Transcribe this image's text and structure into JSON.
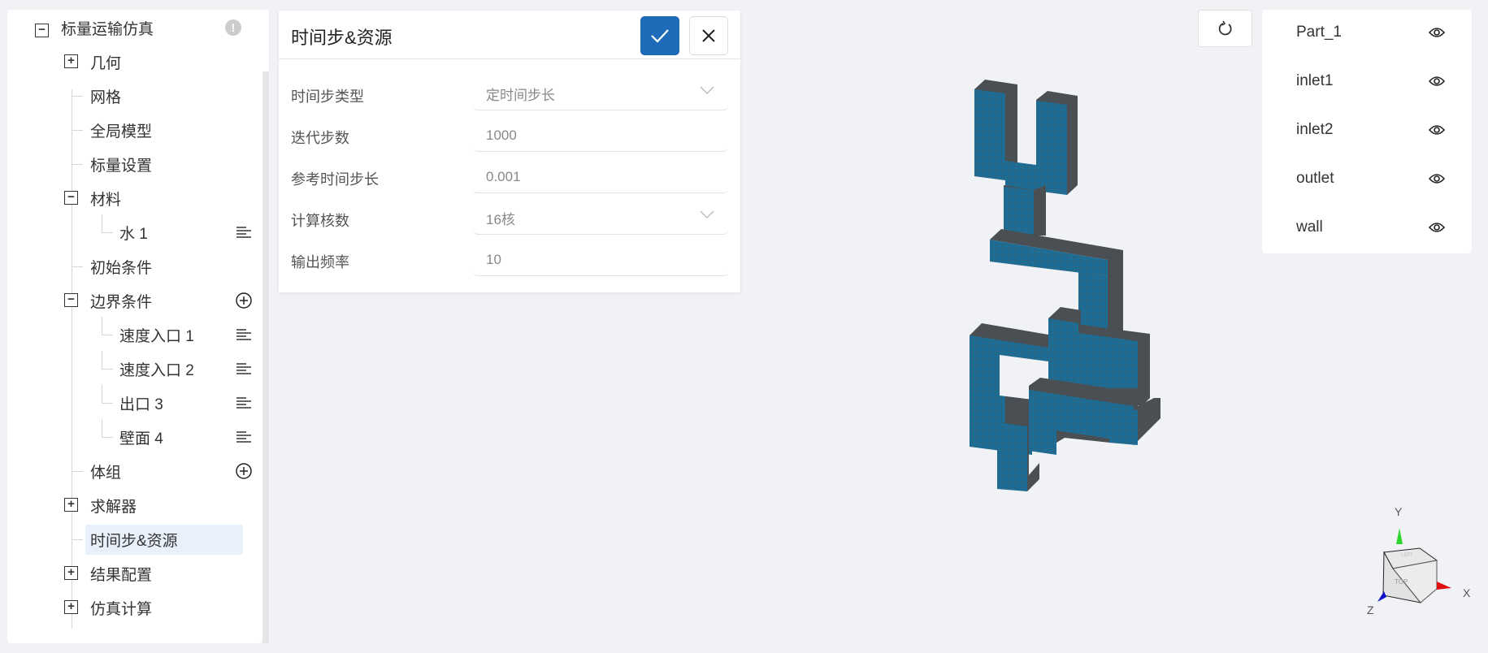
{
  "tree": {
    "root": "标量运输仿真",
    "items": [
      {
        "label": "几何",
        "type": "plus"
      },
      {
        "label": "网格",
        "type": "leaf"
      },
      {
        "label": "全局模型",
        "type": "leaf"
      },
      {
        "label": "标量设置",
        "type": "leaf"
      },
      {
        "label": "材料",
        "type": "minus"
      },
      {
        "label": "水 1",
        "type": "child"
      },
      {
        "label": "初始条件",
        "type": "leaf"
      },
      {
        "label": "边界条件",
        "type": "minus"
      },
      {
        "label": "速度入口 1",
        "type": "child"
      },
      {
        "label": "速度入口 2",
        "type": "child"
      },
      {
        "label": "出口 3",
        "type": "child"
      },
      {
        "label": "壁面 4",
        "type": "child"
      },
      {
        "label": "体组",
        "type": "leaf"
      },
      {
        "label": "求解器",
        "type": "plus"
      },
      {
        "label": "时间步&资源",
        "type": "leaf",
        "selected": true
      },
      {
        "label": "结果配置",
        "type": "plus"
      },
      {
        "label": "仿真计算",
        "type": "plus"
      }
    ]
  },
  "dialog": {
    "title": "时间步&资源",
    "fields": [
      {
        "label": "时间步类型",
        "value": "定时间步长",
        "type": "select"
      },
      {
        "label": "迭代步数",
        "value": "1000",
        "type": "input"
      },
      {
        "label": "参考时间步长",
        "value": "0.001",
        "type": "input"
      },
      {
        "label": "计算核数",
        "value": "16核",
        "type": "select"
      },
      {
        "label": "输出频率",
        "value": "10",
        "type": "input"
      }
    ]
  },
  "parts": [
    "Part_1",
    "inlet1",
    "inlet2",
    "outlet",
    "wall"
  ],
  "axes": {
    "x": "X",
    "y": "Y",
    "z": "Z",
    "cube_top": "TOP",
    "cube_left": "LEFT"
  },
  "colors": {
    "accent": "#1e6bba",
    "mesh": "#1a6f9a",
    "mesh_side": "#4a4f54"
  }
}
